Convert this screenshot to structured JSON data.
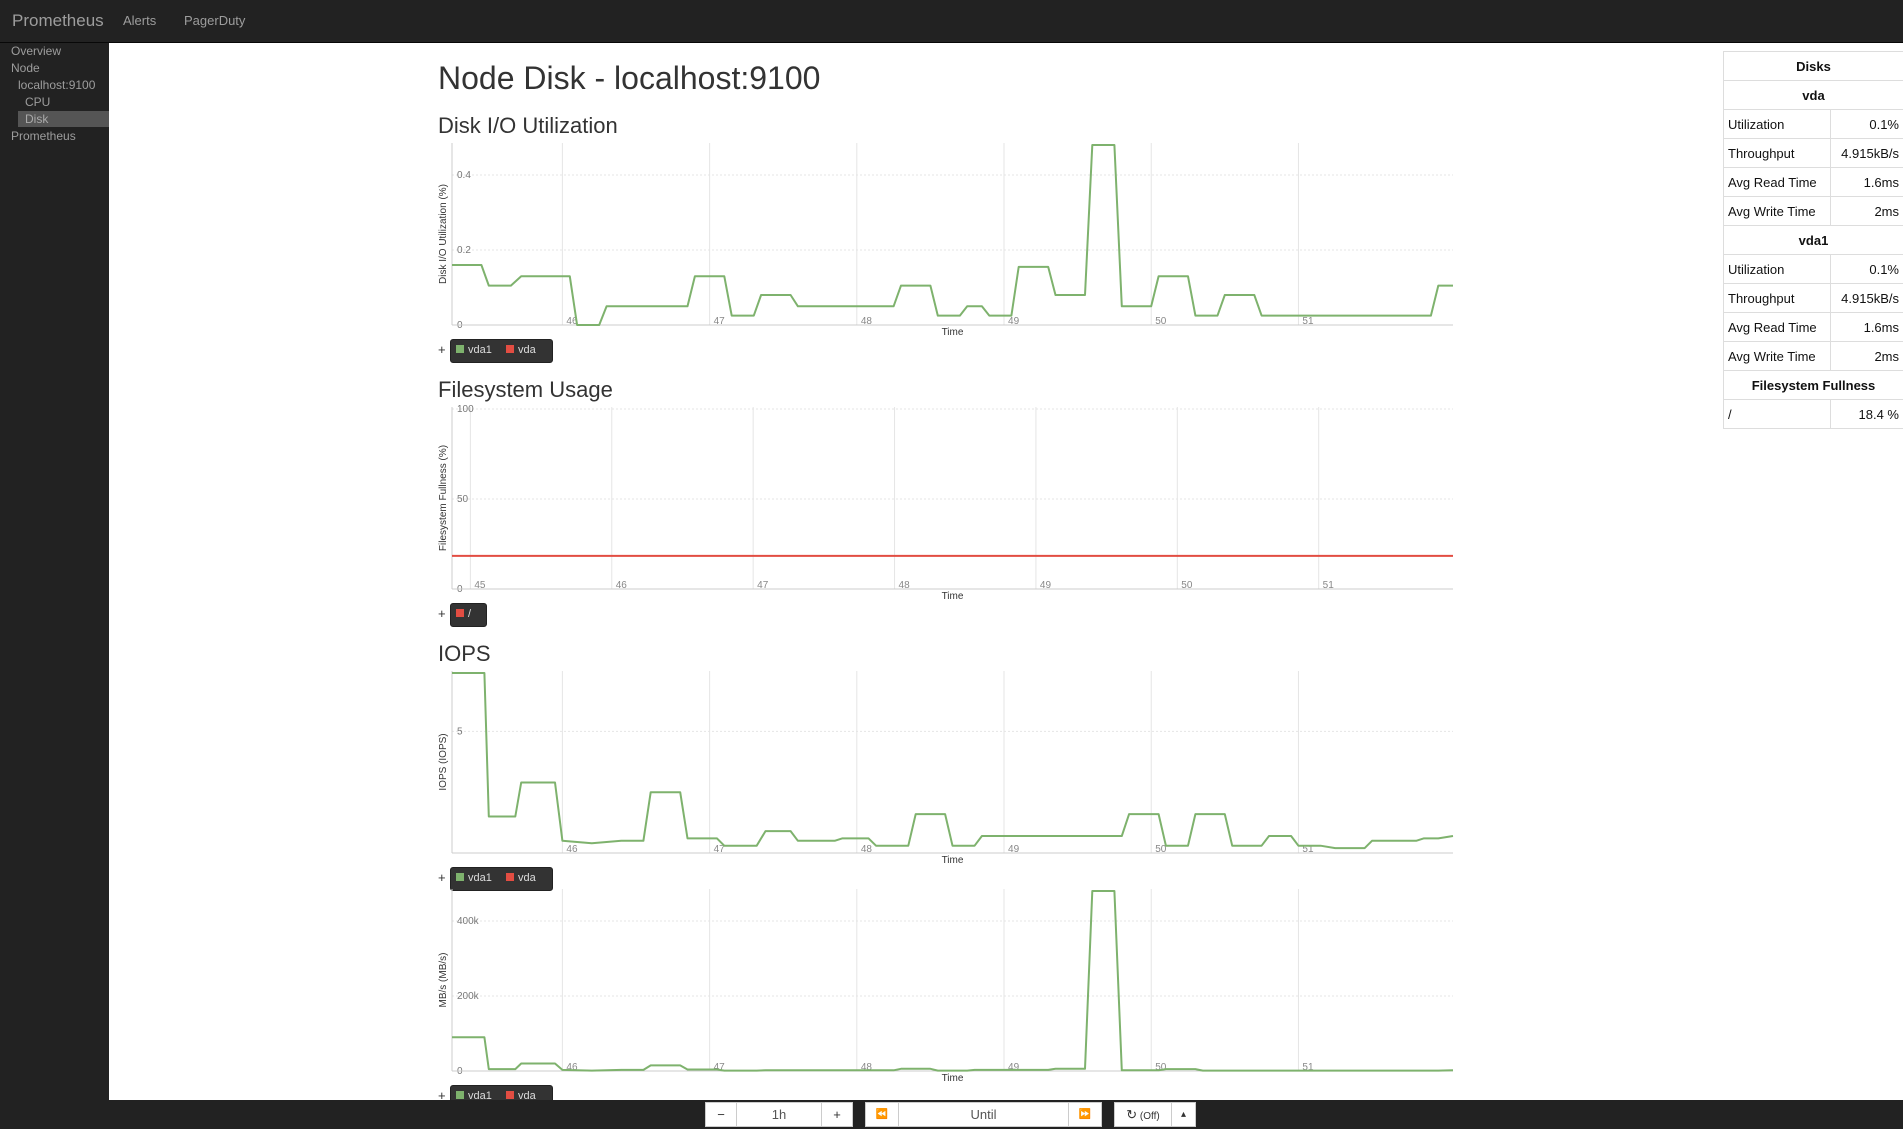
{
  "nav": {
    "brand": "Prometheus",
    "links": [
      "Alerts",
      "PagerDuty"
    ]
  },
  "sidebar": {
    "items": [
      {
        "label": "Overview"
      },
      {
        "label": "Node"
      },
      {
        "label": "localhost:9100"
      },
      {
        "label": "CPU"
      },
      {
        "label": "Disk",
        "active": true
      },
      {
        "label": "Prometheus"
      }
    ]
  },
  "page": {
    "title": "Node Disk - localhost:9100"
  },
  "sections": {
    "io": "Disk I/O Utilization",
    "fs": "Filesystem Usage",
    "iops": "IOPS"
  },
  "colors": {
    "vda1": "#7eb26d",
    "vda": "#e24d42",
    "root": "#e24d42"
  },
  "legends": {
    "io": [
      "vda1",
      "vda"
    ],
    "fs": [
      "/"
    ],
    "iops": [
      "vda1",
      "vda"
    ],
    "mbs": [
      "vda1",
      "vda"
    ],
    "plus": "+"
  },
  "chart_data": [
    {
      "id": "io",
      "type": "line",
      "ylabel": "Disk I/O Utilization (%)",
      "xlabel": "Time",
      "x_ticks": [
        "46",
        "47",
        "48",
        "49",
        "50",
        "51"
      ],
      "y_ticks": [
        0,
        0.2,
        0.4
      ],
      "ylim": [
        0,
        0.48
      ],
      "x_range": [
        45.25,
        52.05
      ],
      "grid": true,
      "series": [
        {
          "name": "vda1",
          "x": [
            45.25,
            45.45,
            45.5,
            45.65,
            45.72,
            45.98,
            46.05,
            46.1,
            46.25,
            46.3,
            46.85,
            46.9,
            47.1,
            47.15,
            47.3,
            47.35,
            47.55,
            47.6,
            48.25,
            48.3,
            48.5,
            48.55,
            48.7,
            48.75,
            48.85,
            48.9,
            49.05,
            49.1,
            49.3,
            49.35,
            49.55,
            49.6,
            49.75,
            49.8,
            50.0,
            50.05,
            50.25,
            50.3,
            50.45,
            50.5,
            50.7,
            50.75,
            50.95,
            51.0,
            51.15,
            51.2,
            51.9,
            51.95,
            52.05
          ],
          "values": [
            0.16,
            0.16,
            0.105,
            0.105,
            0.13,
            0.13,
            0.13,
            0,
            0,
            0.05,
            0.05,
            0.13,
            0.13,
            0.025,
            0.025,
            0.08,
            0.08,
            0.05,
            0.05,
            0.105,
            0.105,
            0.025,
            0.025,
            0.05,
            0.05,
            0.025,
            0.025,
            0.155,
            0.155,
            0.08,
            0.08,
            0.48,
            0.48,
            0.05,
            0.05,
            0.13,
            0.13,
            0.025,
            0.025,
            0.08,
            0.08,
            0.025,
            0.025,
            0.025,
            0.025,
            0.025,
            0.025,
            0.105,
            0.105
          ]
        },
        {
          "name": "vda",
          "x": [],
          "values": []
        }
      ]
    },
    {
      "id": "fs",
      "type": "line",
      "ylabel": "Filesystem Fullness (%)",
      "xlabel": "Time",
      "x_ticks": [
        "45",
        "46",
        "47",
        "48",
        "49",
        "50",
        "51"
      ],
      "y_ticks": [
        0,
        50,
        100
      ],
      "ylim": [
        0,
        100
      ],
      "x_range": [
        44.87,
        51.95
      ],
      "grid": true,
      "series": [
        {
          "name": "/",
          "x": [
            44.87,
            51.95
          ],
          "values": [
            18.4,
            18.4
          ]
        }
      ]
    },
    {
      "id": "iops",
      "type": "line",
      "ylabel": "IOPS (IOPS)",
      "xlabel": "Time",
      "x_ticks": [
        "46",
        "47",
        "48",
        "49",
        "50",
        "51"
      ],
      "y_ticks": [
        5
      ],
      "ylim": [
        0,
        7.4
      ],
      "x_range": [
        45.25,
        52.05
      ],
      "grid": true,
      "series": [
        {
          "name": "vda1",
          "x": [
            45.25,
            45.47,
            45.5,
            45.68,
            45.72,
            45.95,
            46.0,
            46.2,
            46.4,
            46.55,
            46.6,
            46.8,
            46.85,
            47.05,
            47.1,
            47.15,
            47.32,
            47.38,
            47.55,
            47.6,
            47.85,
            47.9,
            48.08,
            48.13,
            48.35,
            48.4,
            48.6,
            48.65,
            48.8,
            48.85,
            49.55,
            49.6,
            49.8,
            49.85,
            50.05,
            50.1,
            50.25,
            50.3,
            50.5,
            50.55,
            50.75,
            50.8,
            50.95,
            51.0,
            51.15,
            51.25,
            51.45,
            51.5,
            51.8,
            51.85,
            51.95,
            52.05
          ],
          "values": [
            7.4,
            7.4,
            1.5,
            1.5,
            2.9,
            2.9,
            0.5,
            0.4,
            0.5,
            0.5,
            2.5,
            2.5,
            0.6,
            0.6,
            0.3,
            0.3,
            0.3,
            0.9,
            0.9,
            0.5,
            0.5,
            0.6,
            0.6,
            0.3,
            0.3,
            1.6,
            1.6,
            0.3,
            0.3,
            0.7,
            0.7,
            0.7,
            0.7,
            1.6,
            1.6,
            0.3,
            0.3,
            1.6,
            1.6,
            0.3,
            0.3,
            0.7,
            0.7,
            0.3,
            0.3,
            0.2,
            0.2,
            0.5,
            0.5,
            0.6,
            0.6,
            0.7
          ]
        },
        {
          "name": "vda",
          "x": [],
          "values": []
        }
      ]
    },
    {
      "id": "mbs",
      "type": "line",
      "ylabel": "MB/s (MB/s)",
      "xlabel": "Time",
      "x_ticks": [
        "46",
        "47",
        "48",
        "49",
        "50",
        "51"
      ],
      "y_ticks": [
        "0",
        "200k",
        "400k"
      ],
      "ylim": [
        0,
        480000
      ],
      "x_range": [
        45.25,
        52.05
      ],
      "grid": true,
      "series": [
        {
          "name": "vda1",
          "x": [
            45.25,
            45.47,
            45.5,
            45.68,
            45.72,
            45.95,
            46.0,
            46.2,
            46.4,
            46.55,
            46.6,
            46.8,
            46.85,
            47.05,
            47.1,
            47.15,
            47.32,
            47.38,
            48.25,
            48.3,
            48.5,
            48.55,
            48.75,
            48.8,
            49.3,
            49.35,
            49.55,
            49.6,
            49.75,
            49.8,
            50.05,
            50.1,
            50.3,
            50.35,
            50.95,
            51.0,
            51.15,
            51.25,
            51.95,
            52.05
          ],
          "values": [
            90000,
            90000,
            5000,
            5000,
            20000,
            20000,
            3000,
            1000,
            3000,
            3000,
            15000,
            15000,
            4000,
            4000,
            1000,
            1000,
            1000,
            2000,
            2000,
            6000,
            6000,
            1000,
            1000,
            3000,
            3000,
            6000,
            6000,
            480000,
            480000,
            2000,
            2000,
            5000,
            5000,
            1000,
            1000,
            1000,
            1000,
            1000,
            1000,
            2000
          ]
        },
        {
          "name": "vda",
          "x": [],
          "values": []
        }
      ]
    }
  ],
  "disks_table": {
    "title": "Disks",
    "devices": [
      {
        "name": "vda",
        "rows": [
          {
            "label": "Utilization",
            "value": "0.1%"
          },
          {
            "label": "Throughput",
            "value": "4.915kB/s"
          },
          {
            "label": "Avg Read Time",
            "value": "1.6ms"
          },
          {
            "label": "Avg Write Time",
            "value": "2ms"
          }
        ]
      },
      {
        "name": "vda1",
        "rows": [
          {
            "label": "Utilization",
            "value": "0.1%"
          },
          {
            "label": "Throughput",
            "value": "4.915kB/s"
          },
          {
            "label": "Avg Read Time",
            "value": "1.6ms"
          },
          {
            "label": "Avg Write Time",
            "value": "2ms"
          }
        ]
      }
    ],
    "fs_title": "Filesystem Fullness",
    "fs_rows": [
      {
        "label": "/",
        "value": "18.4 %"
      }
    ]
  },
  "toolbar": {
    "minus": "−",
    "range": "1h",
    "plus": "+",
    "back": "⏪",
    "until_placeholder": "Until",
    "forward": "⏩",
    "refresh_label": "(Off)",
    "refresh_icon": "↻",
    "caret": "▴"
  }
}
